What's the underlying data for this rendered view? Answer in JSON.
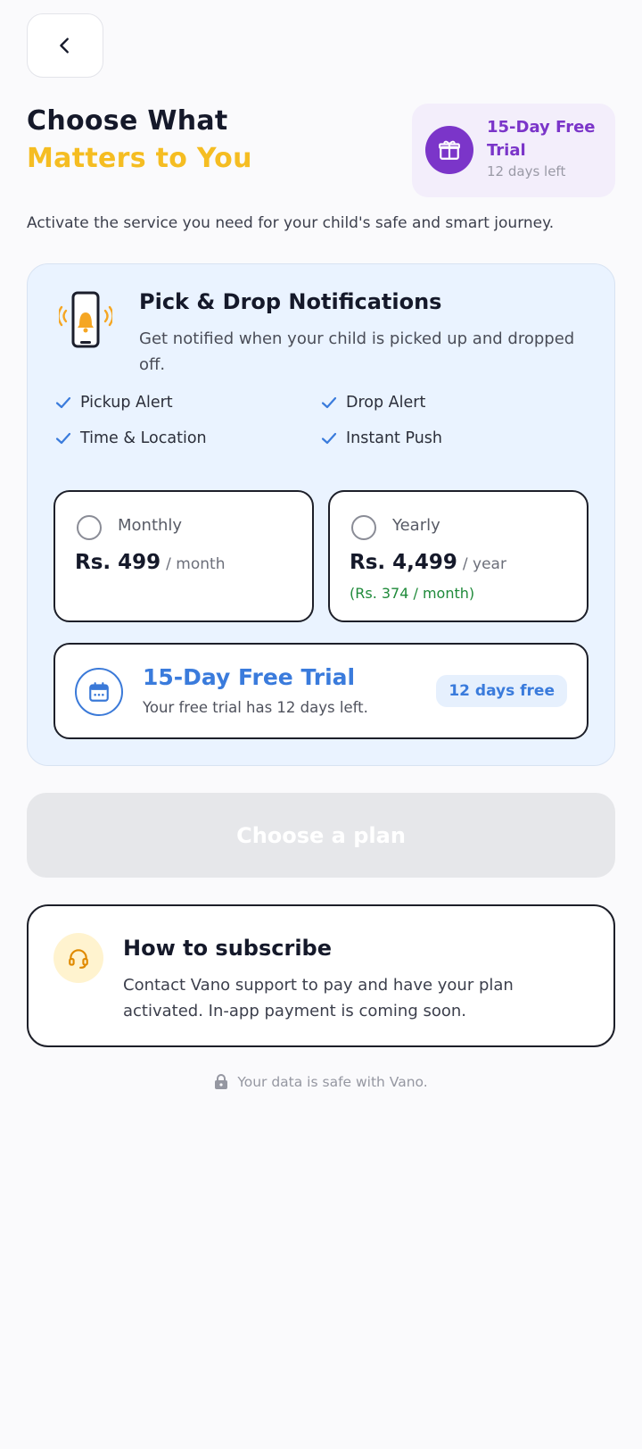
{
  "header": {
    "title_line1": "Choose What",
    "title_line2": "Matters to You"
  },
  "trial_badge": {
    "title": "15-Day Free Trial",
    "subtitle": "12 days left",
    "icon": "gift-icon"
  },
  "subtitle": "Activate the service you need for your child's safe and smart journey.",
  "service": {
    "icon": "phone-bell-icon",
    "title": "Pick & Drop Notifications",
    "description": "Get notified when your child is picked up and dropped off.",
    "features": [
      "Pickup Alert",
      "Drop Alert",
      "Time & Location",
      "Instant Push"
    ]
  },
  "plans": [
    {
      "name": "Monthly",
      "price": "Rs. 499",
      "period": "/ month",
      "note": ""
    },
    {
      "name": "Yearly",
      "price": "Rs. 4,499",
      "period": "/ year",
      "note": "(Rs. 374 / month)"
    }
  ],
  "free_trial": {
    "title": "15-Day Free Trial",
    "description": "Your free trial has 12 days left.",
    "badge": "12 days free",
    "icon": "calendar-icon"
  },
  "cta": {
    "label": "Choose a plan",
    "enabled": false
  },
  "how_to": {
    "icon": "headset-icon",
    "title": "How to subscribe",
    "description": "Contact Vano support to pay and have your plan activated. In-app payment is coming soon."
  },
  "footer": {
    "safe_note": "Your data is safe with Vano.",
    "icon": "lock-icon"
  },
  "colors": {
    "accent_yellow": "#f5bd22",
    "accent_purple": "#7b35c9",
    "accent_blue": "#3a7bdc",
    "success_green": "#1f8a3a"
  }
}
